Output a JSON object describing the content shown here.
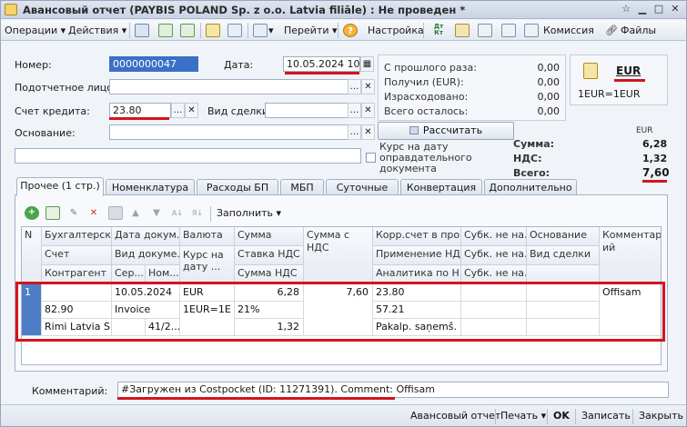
{
  "window": {
    "title": "Авансовый отчет (PAYBIS POLAND Sp. z o.o. Latvia filiāle) : Не проведен *"
  },
  "toolbar": {
    "operations": "Операции",
    "actions": "Действия",
    "goto": "Перейти",
    "help": "?",
    "settings": "Настройка",
    "dt_kt": "Дт Кт",
    "commission": "Комиссия",
    "files": "Файлы"
  },
  "form": {
    "number_label": "Номер:",
    "number_value": "0000000047",
    "date_label": "Дата:",
    "date_value": "10.05.2024 10:4",
    "person_label": "Подотчетное лицо:",
    "person_value": "",
    "credit_account_label": "Счет кредита:",
    "credit_account_value": "23.80",
    "deal_type_label": "Вид сделки:",
    "deal_type_value": "",
    "basis_label": "Основание:",
    "basis_value": "",
    "extra_value": ""
  },
  "summary": {
    "prev_label": "С прошлого раза:",
    "prev_value": "0,00",
    "received_label": "Получил (EUR):",
    "received_value": "0,00",
    "spent_label": "Израсходовано:",
    "spent_value": "0,00",
    "remaining_label": "Всего осталось:",
    "remaining_value": "0,00"
  },
  "currency": {
    "code": "EUR",
    "rate": "1EUR=1EUR"
  },
  "calc_button": "Рассчитать",
  "rate_note": {
    "line1": "Курс на дату",
    "line2": "оправдательного",
    "line3": "документа"
  },
  "totals": {
    "currency": "EUR",
    "sum_label": "Сумма:",
    "sum_value": "6,28",
    "vat_label": "НДС:",
    "vat_value": "1,32",
    "total_label": "Всего:",
    "total_value": "7,60"
  },
  "tabs": [
    "Прочее (1 стр.)",
    "Номенклатура",
    "Расходы БП",
    "МБП",
    "Суточные",
    "Конвертация",
    "Дополнительно"
  ],
  "grid_toolbar": {
    "fill": "Заполнить"
  },
  "grid": {
    "headers": {
      "n": "N",
      "acc_h1": "Бухгалтерск...",
      "acc_h2": "Счет",
      "acc_h3": "Контрагент",
      "doc_h1": "Дата докум...",
      "doc_h2": "Вид докуме...",
      "doc_h3a": "Сер...",
      "doc_h3b": "Ном...",
      "cur_h1": "Валюта",
      "cur_h2": "Курс на дату ...",
      "sum_h1": "Сумма",
      "sum_h2": "Ставка НДС",
      "sum_h3": "Сумма НДС",
      "sumvat_h1": "Сумма с НДС",
      "corr_h1": "Корр.счет в про...",
      "corr_h2": "Применение НД...",
      "corr_h3": "Аналитика по Н...",
      "sub_h1": "Субк. не на...",
      "sub_h2": "Субк. не на...",
      "sub_h3": "Субк. не на...",
      "basis_h1": "Основание",
      "basis_h2": "Вид сделки",
      "comment_h1": "Комментар",
      "comment_h2": "ий"
    },
    "row": {
      "n": "1",
      "acc_r2": "82.90",
      "acc_r3": "Rimi Latvia S...",
      "doc_date": "10.05.2024",
      "doc_type": "Invoice",
      "doc_num": "41/2...",
      "currency": "EUR",
      "rate": "1EUR=1E",
      "sum": "6,28",
      "vat_rate": "21%",
      "vat_sum": "1,32",
      "sum_with_vat": "7,60",
      "corr_account": "23.80",
      "vat_application": "57.21",
      "vat_analytics": "Pakalp. saņemš. ...",
      "comment": "Offisam"
    }
  },
  "comment": {
    "label": "Комментарий:",
    "value": "#Загружен из Costpocket (ID: 11271391). Comment: Offisam"
  },
  "statusbar": {
    "report": "Авансовый отчет",
    "print": "Печать",
    "ok": "OK",
    "save": "Записать",
    "close": "Закрыть"
  }
}
